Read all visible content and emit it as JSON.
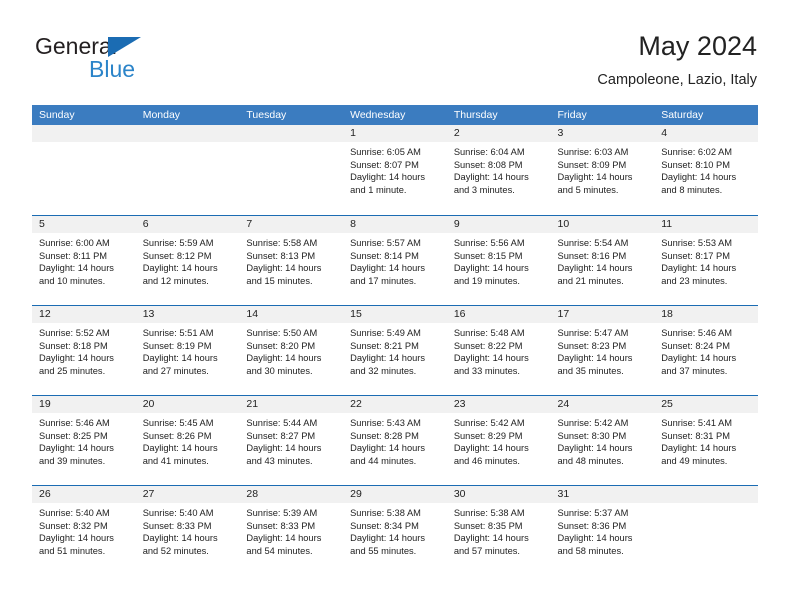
{
  "brand": {
    "name_primary": "General",
    "name_secondary": "Blue",
    "accent_color": "#2b84c9",
    "triangle_color": "#1b6cb3"
  },
  "header": {
    "title": "May 2024",
    "subtitle": "Campoleone, Lazio, Italy"
  },
  "theme": {
    "header_blue": "#3b7cc0",
    "rule_blue": "#1b6cb3",
    "day_band_gray": "#f1f1f1",
    "text_color": "#222222"
  },
  "weekdays": [
    "Sunday",
    "Monday",
    "Tuesday",
    "Wednesday",
    "Thursday",
    "Friday",
    "Saturday"
  ],
  "weeks": [
    [
      {
        "day": "",
        "sunrise": "",
        "sunset": "",
        "daylight_a": "",
        "daylight_b": "",
        "empty": true
      },
      {
        "day": "",
        "sunrise": "",
        "sunset": "",
        "daylight_a": "",
        "daylight_b": "",
        "empty": true
      },
      {
        "day": "",
        "sunrise": "",
        "sunset": "",
        "daylight_a": "",
        "daylight_b": "",
        "empty": true
      },
      {
        "day": "1",
        "sunrise": "Sunrise: 6:05 AM",
        "sunset": "Sunset: 8:07 PM",
        "daylight_a": "Daylight: 14 hours",
        "daylight_b": "and 1 minute.",
        "empty": false
      },
      {
        "day": "2",
        "sunrise": "Sunrise: 6:04 AM",
        "sunset": "Sunset: 8:08 PM",
        "daylight_a": "Daylight: 14 hours",
        "daylight_b": "and 3 minutes.",
        "empty": false
      },
      {
        "day": "3",
        "sunrise": "Sunrise: 6:03 AM",
        "sunset": "Sunset: 8:09 PM",
        "daylight_a": "Daylight: 14 hours",
        "daylight_b": "and 5 minutes.",
        "empty": false
      },
      {
        "day": "4",
        "sunrise": "Sunrise: 6:02 AM",
        "sunset": "Sunset: 8:10 PM",
        "daylight_a": "Daylight: 14 hours",
        "daylight_b": "and 8 minutes.",
        "empty": false
      }
    ],
    [
      {
        "day": "5",
        "sunrise": "Sunrise: 6:00 AM",
        "sunset": "Sunset: 8:11 PM",
        "daylight_a": "Daylight: 14 hours",
        "daylight_b": "and 10 minutes.",
        "empty": false
      },
      {
        "day": "6",
        "sunrise": "Sunrise: 5:59 AM",
        "sunset": "Sunset: 8:12 PM",
        "daylight_a": "Daylight: 14 hours",
        "daylight_b": "and 12 minutes.",
        "empty": false
      },
      {
        "day": "7",
        "sunrise": "Sunrise: 5:58 AM",
        "sunset": "Sunset: 8:13 PM",
        "daylight_a": "Daylight: 14 hours",
        "daylight_b": "and 15 minutes.",
        "empty": false
      },
      {
        "day": "8",
        "sunrise": "Sunrise: 5:57 AM",
        "sunset": "Sunset: 8:14 PM",
        "daylight_a": "Daylight: 14 hours",
        "daylight_b": "and 17 minutes.",
        "empty": false
      },
      {
        "day": "9",
        "sunrise": "Sunrise: 5:56 AM",
        "sunset": "Sunset: 8:15 PM",
        "daylight_a": "Daylight: 14 hours",
        "daylight_b": "and 19 minutes.",
        "empty": false
      },
      {
        "day": "10",
        "sunrise": "Sunrise: 5:54 AM",
        "sunset": "Sunset: 8:16 PM",
        "daylight_a": "Daylight: 14 hours",
        "daylight_b": "and 21 minutes.",
        "empty": false
      },
      {
        "day": "11",
        "sunrise": "Sunrise: 5:53 AM",
        "sunset": "Sunset: 8:17 PM",
        "daylight_a": "Daylight: 14 hours",
        "daylight_b": "and 23 minutes.",
        "empty": false
      }
    ],
    [
      {
        "day": "12",
        "sunrise": "Sunrise: 5:52 AM",
        "sunset": "Sunset: 8:18 PM",
        "daylight_a": "Daylight: 14 hours",
        "daylight_b": "and 25 minutes.",
        "empty": false
      },
      {
        "day": "13",
        "sunrise": "Sunrise: 5:51 AM",
        "sunset": "Sunset: 8:19 PM",
        "daylight_a": "Daylight: 14 hours",
        "daylight_b": "and 27 minutes.",
        "empty": false
      },
      {
        "day": "14",
        "sunrise": "Sunrise: 5:50 AM",
        "sunset": "Sunset: 8:20 PM",
        "daylight_a": "Daylight: 14 hours",
        "daylight_b": "and 30 minutes.",
        "empty": false
      },
      {
        "day": "15",
        "sunrise": "Sunrise: 5:49 AM",
        "sunset": "Sunset: 8:21 PM",
        "daylight_a": "Daylight: 14 hours",
        "daylight_b": "and 32 minutes.",
        "empty": false
      },
      {
        "day": "16",
        "sunrise": "Sunrise: 5:48 AM",
        "sunset": "Sunset: 8:22 PM",
        "daylight_a": "Daylight: 14 hours",
        "daylight_b": "and 33 minutes.",
        "empty": false
      },
      {
        "day": "17",
        "sunrise": "Sunrise: 5:47 AM",
        "sunset": "Sunset: 8:23 PM",
        "daylight_a": "Daylight: 14 hours",
        "daylight_b": "and 35 minutes.",
        "empty": false
      },
      {
        "day": "18",
        "sunrise": "Sunrise: 5:46 AM",
        "sunset": "Sunset: 8:24 PM",
        "daylight_a": "Daylight: 14 hours",
        "daylight_b": "and 37 minutes.",
        "empty": false
      }
    ],
    [
      {
        "day": "19",
        "sunrise": "Sunrise: 5:46 AM",
        "sunset": "Sunset: 8:25 PM",
        "daylight_a": "Daylight: 14 hours",
        "daylight_b": "and 39 minutes.",
        "empty": false
      },
      {
        "day": "20",
        "sunrise": "Sunrise: 5:45 AM",
        "sunset": "Sunset: 8:26 PM",
        "daylight_a": "Daylight: 14 hours",
        "daylight_b": "and 41 minutes.",
        "empty": false
      },
      {
        "day": "21",
        "sunrise": "Sunrise: 5:44 AM",
        "sunset": "Sunset: 8:27 PM",
        "daylight_a": "Daylight: 14 hours",
        "daylight_b": "and 43 minutes.",
        "empty": false
      },
      {
        "day": "22",
        "sunrise": "Sunrise: 5:43 AM",
        "sunset": "Sunset: 8:28 PM",
        "daylight_a": "Daylight: 14 hours",
        "daylight_b": "and 44 minutes.",
        "empty": false
      },
      {
        "day": "23",
        "sunrise": "Sunrise: 5:42 AM",
        "sunset": "Sunset: 8:29 PM",
        "daylight_a": "Daylight: 14 hours",
        "daylight_b": "and 46 minutes.",
        "empty": false
      },
      {
        "day": "24",
        "sunrise": "Sunrise: 5:42 AM",
        "sunset": "Sunset: 8:30 PM",
        "daylight_a": "Daylight: 14 hours",
        "daylight_b": "and 48 minutes.",
        "empty": false
      },
      {
        "day": "25",
        "sunrise": "Sunrise: 5:41 AM",
        "sunset": "Sunset: 8:31 PM",
        "daylight_a": "Daylight: 14 hours",
        "daylight_b": "and 49 minutes.",
        "empty": false
      }
    ],
    [
      {
        "day": "26",
        "sunrise": "Sunrise: 5:40 AM",
        "sunset": "Sunset: 8:32 PM",
        "daylight_a": "Daylight: 14 hours",
        "daylight_b": "and 51 minutes.",
        "empty": false
      },
      {
        "day": "27",
        "sunrise": "Sunrise: 5:40 AM",
        "sunset": "Sunset: 8:33 PM",
        "daylight_a": "Daylight: 14 hours",
        "daylight_b": "and 52 minutes.",
        "empty": false
      },
      {
        "day": "28",
        "sunrise": "Sunrise: 5:39 AM",
        "sunset": "Sunset: 8:33 PM",
        "daylight_a": "Daylight: 14 hours",
        "daylight_b": "and 54 minutes.",
        "empty": false
      },
      {
        "day": "29",
        "sunrise": "Sunrise: 5:38 AM",
        "sunset": "Sunset: 8:34 PM",
        "daylight_a": "Daylight: 14 hours",
        "daylight_b": "and 55 minutes.",
        "empty": false
      },
      {
        "day": "30",
        "sunrise": "Sunrise: 5:38 AM",
        "sunset": "Sunset: 8:35 PM",
        "daylight_a": "Daylight: 14 hours",
        "daylight_b": "and 57 minutes.",
        "empty": false
      },
      {
        "day": "31",
        "sunrise": "Sunrise: 5:37 AM",
        "sunset": "Sunset: 8:36 PM",
        "daylight_a": "Daylight: 14 hours",
        "daylight_b": "and 58 minutes.",
        "empty": false
      },
      {
        "day": "",
        "sunrise": "",
        "sunset": "",
        "daylight_a": "",
        "daylight_b": "",
        "empty": true
      }
    ]
  ]
}
